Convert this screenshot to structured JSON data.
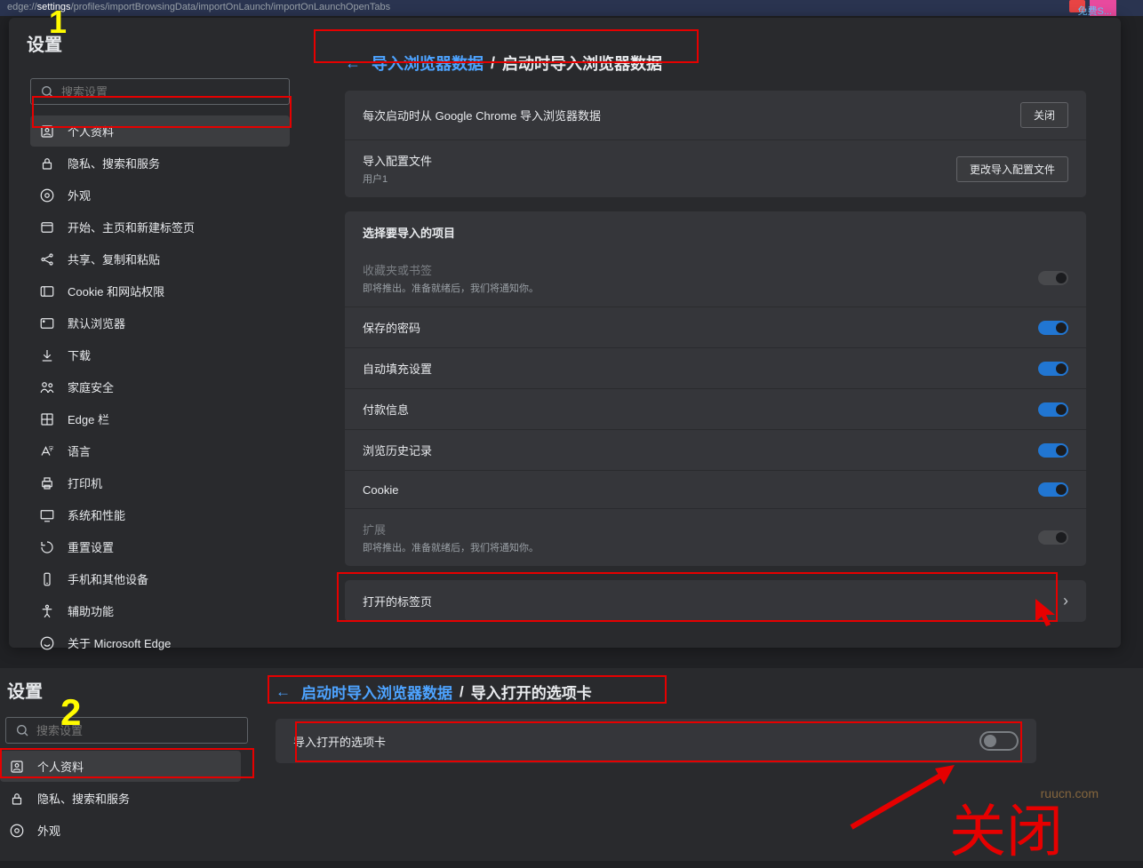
{
  "addr_prefix": "edge://",
  "addr_bold": "settings",
  "addr_rest": "/profiles/importBrowsingData/importOnLaunch/importOnLaunchOpenTabs",
  "tab_right": "免费S...",
  "settings_title": "设置",
  "search_placeholder": "搜索设置",
  "anno1": "1",
  "anno2": "2",
  "nav": [
    {
      "icon": "profile",
      "label": "个人资料"
    },
    {
      "icon": "lock",
      "label": "隐私、搜索和服务"
    },
    {
      "icon": "eye",
      "label": "外观"
    },
    {
      "icon": "home",
      "label": "开始、主页和新建标签页"
    },
    {
      "icon": "share",
      "label": "共享、复制和粘贴"
    },
    {
      "icon": "cookie",
      "label": "Cookie 和网站权限"
    },
    {
      "icon": "browser",
      "label": "默认浏览器"
    },
    {
      "icon": "download",
      "label": "下载"
    },
    {
      "icon": "family",
      "label": "家庭安全"
    },
    {
      "icon": "edge",
      "label": "Edge 栏"
    },
    {
      "icon": "lang",
      "label": "语言"
    },
    {
      "icon": "printer",
      "label": "打印机"
    },
    {
      "icon": "system",
      "label": "系统和性能"
    },
    {
      "icon": "reset",
      "label": "重置设置"
    },
    {
      "icon": "phone",
      "label": "手机和其他设备"
    },
    {
      "icon": "a11y",
      "label": "辅助功能"
    },
    {
      "icon": "about",
      "label": "关于 Microsoft Edge"
    }
  ],
  "crumb1": {
    "back": "←",
    "link": "导入浏览器数据",
    "cur": "启动时导入浏览器数据"
  },
  "card1": {
    "r1_label": "每次启动时从 Google Chrome 导入浏览器数据",
    "r1_btn": "关闭",
    "r2_label": "导入配置文件",
    "r2_sub": "用户1",
    "r2_btn": "更改导入配置文件"
  },
  "card2": {
    "title": "选择要导入的项目",
    "coming_soon": "即将推出。准备就绪后，我们将通知你。",
    "items": [
      {
        "label": "收藏夹或书签",
        "disabled": true,
        "sub": true
      },
      {
        "label": "保存的密码",
        "on": true
      },
      {
        "label": "自动填充设置",
        "on": true
      },
      {
        "label": "付款信息",
        "on": true
      },
      {
        "label": "浏览历史记录",
        "on": true
      },
      {
        "label": "Cookie",
        "on": true
      },
      {
        "label": "扩展",
        "disabled": true,
        "sub": true
      }
    ]
  },
  "card3_label": "打开的标签页",
  "crumb2": {
    "back": "←",
    "link": "启动时导入浏览器数据",
    "cur": "导入打开的选项卡"
  },
  "card4_label": "导入打开的选项卡",
  "big_anno": "关闭",
  "watermark": "ruucn.com"
}
